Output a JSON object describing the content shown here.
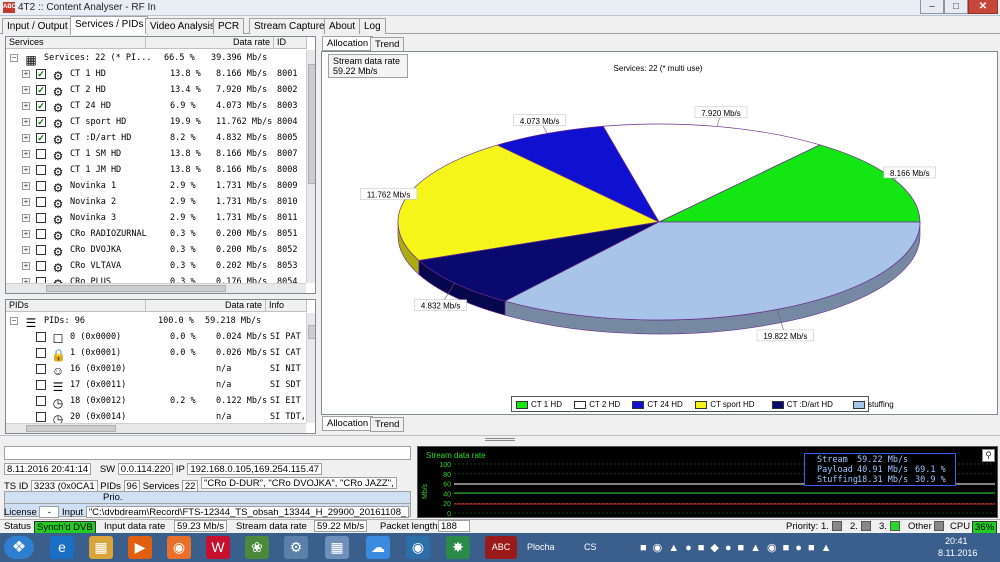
{
  "window": {
    "title": "4T2 :: Content Analyser - RF In",
    "app_icon_text": "ABC"
  },
  "main_tabs": [
    "Input / Output",
    "Services / PIDs",
    "Video Analysis",
    "PCR",
    "Stream Capture",
    "About",
    "Log"
  ],
  "services_panel": {
    "headers": {
      "name": "Services",
      "rate": "Data rate",
      "id": "ID"
    },
    "root": {
      "label": "Services: 22 (* PI...",
      "pct": "66.5 %",
      "rate": "39.396 Mb/s"
    },
    "rows": [
      {
        "name": "CT 1 HD",
        "pct": "13.8 %",
        "rate": "8.166 Mb/s",
        "id": "8001",
        "checked": true
      },
      {
        "name": "CT 2 HD",
        "pct": "13.4 %",
        "rate": "7.920 Mb/s",
        "id": "8002",
        "checked": true
      },
      {
        "name": "CT 24 HD",
        "pct": "6.9 %",
        "rate": "4.073 Mb/s",
        "id": "8003",
        "checked": true
      },
      {
        "name": "CT sport HD",
        "pct": "19.9 %",
        "rate": "11.762 Mb/s",
        "id": "8004",
        "checked": true
      },
      {
        "name": "CT :D/art HD",
        "pct": "8.2 %",
        "rate": "4.832 Mb/s",
        "id": "8005",
        "checked": true
      },
      {
        "name": "CT 1 SM HD",
        "pct": "13.8 %",
        "rate": "8.166 Mb/s",
        "id": "8007",
        "checked": false
      },
      {
        "name": "CT 1 JM HD",
        "pct": "13.8 %",
        "rate": "8.166 Mb/s",
        "id": "8008",
        "checked": false
      },
      {
        "name": "Novinka 1",
        "pct": "2.9 %",
        "rate": "1.731 Mb/s",
        "id": "8009",
        "checked": false
      },
      {
        "name": "Novinka 2",
        "pct": "2.9 %",
        "rate": "1.731 Mb/s",
        "id": "8010",
        "checked": false
      },
      {
        "name": "Novinka 3",
        "pct": "2.9 %",
        "rate": "1.731 Mb/s",
        "id": "8011",
        "checked": false
      },
      {
        "name": "CRo RADIOZURNAL",
        "pct": "0.3 %",
        "rate": "0.200 Mb/s",
        "id": "8051",
        "checked": false
      },
      {
        "name": "CRo DVOJKA",
        "pct": "0.3 %",
        "rate": "0.200 Mb/s",
        "id": "8052",
        "checked": false
      },
      {
        "name": "CRo VLTAVA",
        "pct": "0.3 %",
        "rate": "0.202 Mb/s",
        "id": "8053",
        "checked": false
      },
      {
        "name": "CRo PLUS",
        "pct": "0.3 %",
        "rate": "0.176 Mb/s",
        "id": "8054",
        "checked": false
      }
    ]
  },
  "pids_panel": {
    "headers": {
      "name": "PIDs",
      "rate": "Data rate",
      "info": "Info"
    },
    "root": {
      "label": "PIDs: 96",
      "pct": "100.0 %",
      "rate": "59.218 Mb/s"
    },
    "rows": [
      {
        "name": "0 (0x0000)",
        "pct": "0.0 %",
        "rate": "0.024 Mb/s",
        "info": "SI PAT"
      },
      {
        "name": "1 (0x0001)",
        "pct": "0.0 %",
        "rate": "0.026 Mb/s",
        "info": "SI CAT"
      },
      {
        "name": "16 (0x0010)",
        "pct": "",
        "rate": "n/a",
        "info": "SI NIT"
      },
      {
        "name": "17 (0x0011)",
        "pct": "",
        "rate": "n/a",
        "info": "SI SDT"
      },
      {
        "name": "18 (0x0012)",
        "pct": "0.2 %",
        "rate": "0.122 Mb/s",
        "info": "SI EIT"
      },
      {
        "name": "20 (0x0014)",
        "pct": "",
        "rate": "n/a",
        "info": "SI TDT,"
      }
    ]
  },
  "allocation": {
    "tabs": [
      "Allocation",
      "Trend"
    ],
    "stream_rate_label": "Stream data rate",
    "stream_rate_value": "59.22 Mb/s",
    "bottom_tabs": [
      "Allocation",
      "Trend"
    ]
  },
  "chart_data": {
    "type": "pie",
    "title": "Services: 22 (* multi use)",
    "slices": [
      {
        "name": "CT 1 HD",
        "value": 8.166,
        "label": "8.166 Mb/s",
        "color": "#14e614"
      },
      {
        "name": "CT 2 HD",
        "value": 7.92,
        "label": "7.920 Mb/s",
        "color": "#ffffff"
      },
      {
        "name": "CT 24 HD",
        "value": 4.073,
        "label": "4.073 Mb/s",
        "color": "#1010d0"
      },
      {
        "name": "CT sport HD",
        "value": 11.762,
        "label": "11.762 Mb/s",
        "color": "#f5f51a"
      },
      {
        "name": "CT :D/art HD",
        "value": 4.832,
        "label": "4.832 Mb/s",
        "color": "#0a0a6e"
      },
      {
        "name": "stuffing",
        "value": 19.822,
        "label": "19.822 Mb/s",
        "color": "#a8c4e8"
      }
    ],
    "legend": "bottom"
  },
  "info": {
    "datetime": "8.11.2016 20:41:14",
    "sw_label": "SW",
    "sw": "0.0.114.220",
    "ip_label": "IP",
    "ip": "192.168.0.105,169.254.115.47",
    "tsid_label": "TS ID",
    "tsid": "3233 (0x0CA1",
    "pids_label": "PIDs",
    "pids": "96",
    "services_label": "Services",
    "services": "22",
    "services_list": "\"CRo D-DUR\", \"CRo DVOJKA\", \"CRo JAZZ\", \"C",
    "prio_label": "Prio.",
    "license_label": "License",
    "license_value": "-",
    "input_label": "Input",
    "input_value": "\"C:\\dvbdream\\Record\\FTS-12344_TS_obsah_13344_H_29900_20161108_"
  },
  "monitor": {
    "title": "Stream data rate",
    "y_unit": "Mb/s",
    "y_ticks": [
      "100",
      "80",
      "60",
      "40",
      "20",
      "0"
    ],
    "stats": [
      {
        "label": "Stream",
        "value": "59.22 Mb/s",
        "pct": ""
      },
      {
        "label": "Payload",
        "value": "40.91 Mb/s",
        "pct": "69.1 %"
      },
      {
        "label": "Stuffing",
        "value": "18.31 Mb/s",
        "pct": "30.9 %"
      }
    ],
    "colors": {
      "stream": "#ffffff",
      "payload": "#2dd62d",
      "stuffing": "#e02020"
    }
  },
  "status": {
    "status_label": "Status",
    "status_value": "Synch'd DVB",
    "input_rate_label": "Input data rate",
    "input_rate": "59.23 Mb/s",
    "stream_rate_label": "Stream data rate",
    "stream_rate": "59.22 Mb/s",
    "packet_label": "Packet length",
    "packet": "188",
    "priority_label": "Priority:",
    "p1": "1.",
    "p2": "2.",
    "p3": "3.",
    "other": "Other",
    "cpu_label": "CPU",
    "cpu": "36%"
  },
  "taskbar": {
    "clock_time": "20:41",
    "clock_date": "8.11.2016",
    "plocha": "Plocha",
    "lang": "CS"
  }
}
